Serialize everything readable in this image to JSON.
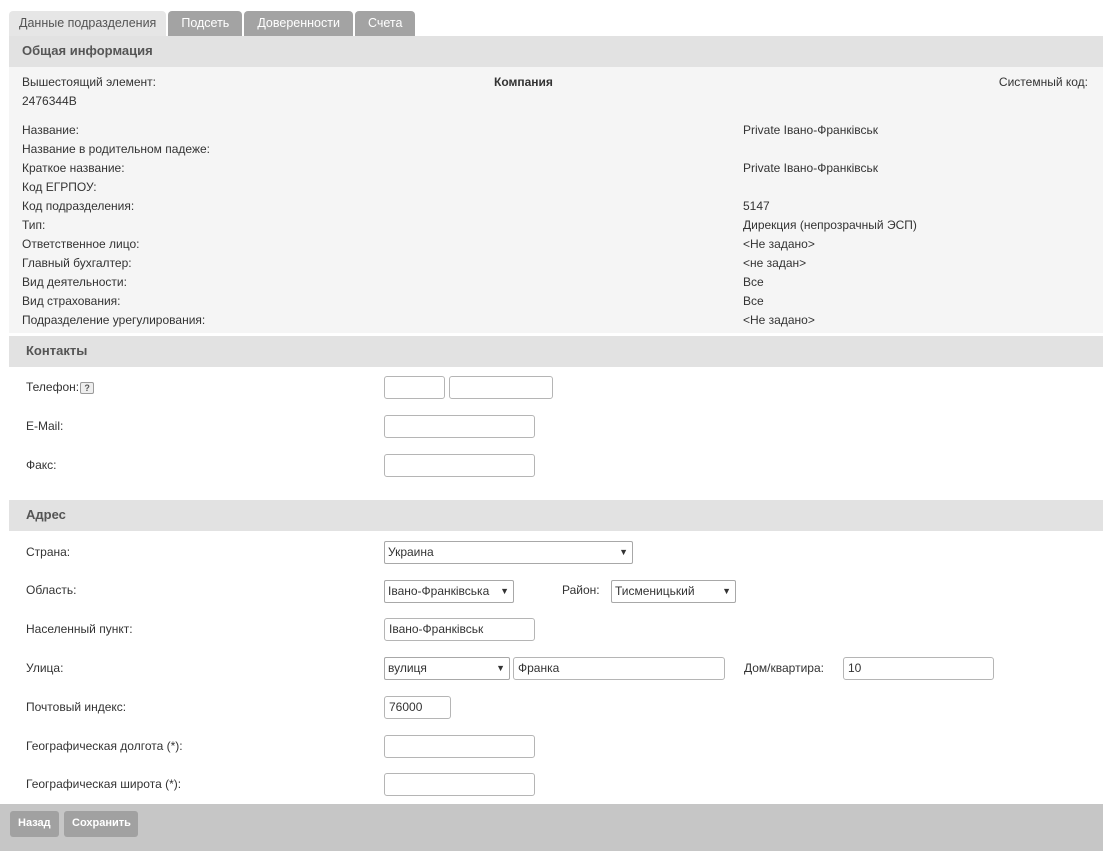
{
  "tabs": [
    "Данные подразделения",
    "Подсеть",
    "Доверенности",
    "Счета"
  ],
  "general": {
    "header": "Общая информация",
    "parent_label": "Вышестоящий элемент:",
    "parent_value": "2476344B",
    "company_label": "Компания",
    "system_code_label": "Системный код:",
    "rows": [
      {
        "label": "Название:",
        "value": "Private Івано-Франківськ"
      },
      {
        "label": "Название в родительном падеже:",
        "value": ""
      },
      {
        "label": "Краткое название:",
        "value": "Private Івано-Франківськ"
      },
      {
        "label": "Код ЕГРПОУ:",
        "value": ""
      },
      {
        "label": "Код подразделения:",
        "value": "5147"
      },
      {
        "label": "Тип:",
        "value": "Дирекция (непрозрачный ЭСП)"
      },
      {
        "label": "Ответственное лицо:",
        "value": "<Не задано>"
      },
      {
        "label": "Главный бухгалтер:",
        "value": "<не задан>"
      },
      {
        "label": "Вид деятельности:",
        "value": "Все"
      },
      {
        "label": "Вид страхования:",
        "value": "Все"
      },
      {
        "label": "Подразделение урегулирования:",
        "value": "<Не задано>"
      }
    ]
  },
  "contacts": {
    "header": "Контакты",
    "phone_label": "Телефон:",
    "help_icon": "?",
    "phone_code": "",
    "phone_number": "",
    "email_label": "E-Mail:",
    "email": "",
    "fax_label": "Факс:",
    "fax": ""
  },
  "address": {
    "header": "Адрес",
    "country_label": "Страна:",
    "country": "Украина",
    "region_label": "Область:",
    "region": "Івано-Франківська",
    "district_label": "Район:",
    "district": "Тисменицький",
    "settlement_label": "Населенный пункт:",
    "settlement": "Івано-Франківськ",
    "street_label": "Улица:",
    "street_type": "вулиця",
    "street": "Франка",
    "house_label": "Дом/квартира:",
    "house": "10",
    "postal_label": "Почтовый индекс:",
    "postal": "76000",
    "longitude_label": "Географическая долгота (*):",
    "longitude": "",
    "latitude_label": "Географическая широта (*):",
    "latitude": ""
  },
  "footer": {
    "back_label": "Назад",
    "save_label": "Сохранить"
  },
  "icons": {
    "dropdown_arrow": "▼"
  }
}
